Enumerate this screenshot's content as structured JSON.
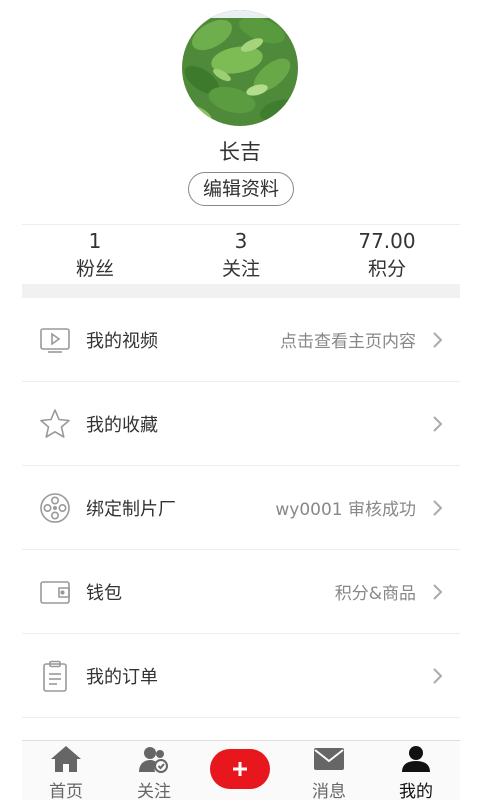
{
  "profile": {
    "username": "长吉",
    "edit_label": "编辑资料"
  },
  "stats": [
    {
      "value": "1",
      "label": "粉丝"
    },
    {
      "value": "3",
      "label": "关注"
    },
    {
      "value": "77.00",
      "label": "积分"
    }
  ],
  "menu": [
    {
      "icon": "video-icon",
      "label": "我的视频",
      "hint": "点击查看主页内容"
    },
    {
      "icon": "star-icon",
      "label": "我的收藏",
      "hint": ""
    },
    {
      "icon": "film-reel-icon",
      "label": "绑定制片厂",
      "hint": "wy0001 审核成功"
    },
    {
      "icon": "wallet-icon",
      "label": "钱包",
      "hint": "积分&商品"
    },
    {
      "icon": "clipboard-icon",
      "label": "我的订单",
      "hint": ""
    }
  ],
  "tabbar": {
    "home": "首页",
    "follow": "关注",
    "messages": "消息",
    "mine": "我的"
  },
  "colors": {
    "accent": "#e8171d",
    "icon_gray": "#999999",
    "tab_icon": "#666666"
  }
}
